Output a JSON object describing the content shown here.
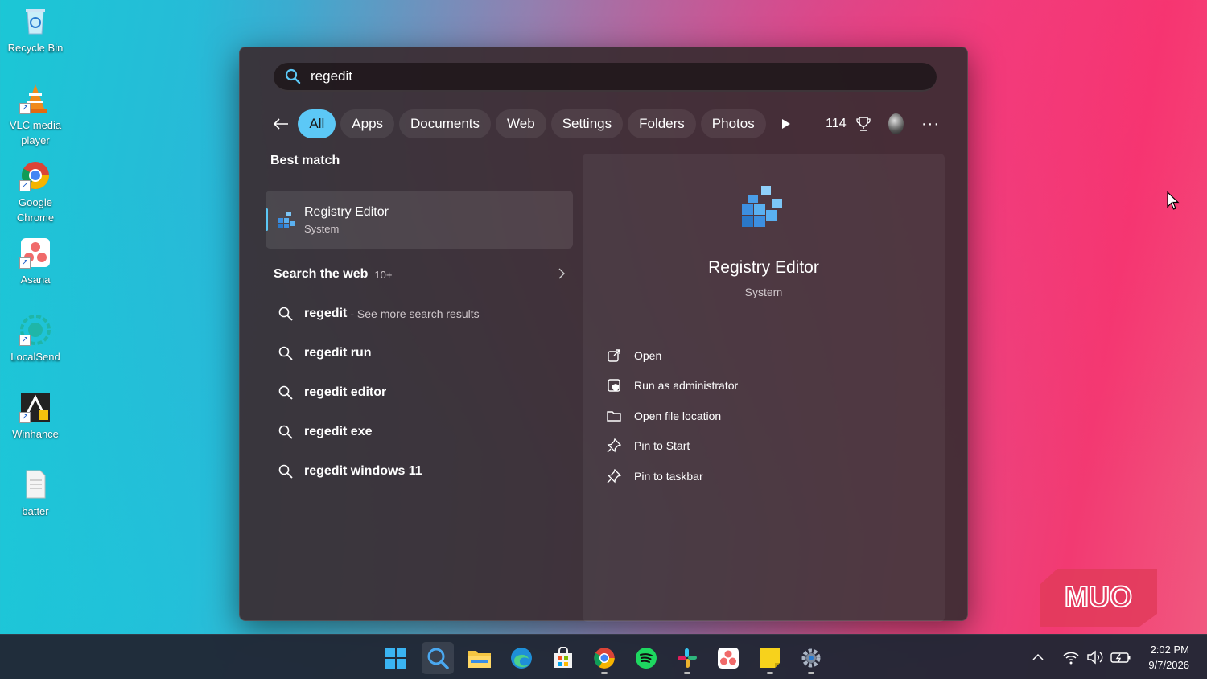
{
  "desktop": {
    "icons": [
      {
        "label": "Recycle Bin",
        "icon": "recycle-bin-icon"
      },
      {
        "label": "VLC media player",
        "icon": "vlc-icon"
      },
      {
        "label": "Google Chrome",
        "icon": "chrome-icon"
      },
      {
        "label": "Asana",
        "icon": "asana-icon"
      },
      {
        "label": "LocalSend",
        "icon": "localsend-icon"
      },
      {
        "label": "Winhance",
        "icon": "winhance-icon"
      },
      {
        "label": "batter",
        "icon": "text-file-icon"
      }
    ]
  },
  "search": {
    "query": "regedit",
    "filters": [
      "All",
      "Apps",
      "Documents",
      "Web",
      "Settings",
      "Folders",
      "Photos"
    ],
    "active_filter": "All",
    "points_count": "114"
  },
  "results": {
    "best_match_title": "Best match",
    "best_match": {
      "name": "Registry Editor",
      "type": "System"
    },
    "web_section_title": "Search the web",
    "web_section_count": "10+",
    "web_items": [
      {
        "text": "regedit",
        "sub": "- See more search results"
      },
      {
        "text": "regedit run",
        "sub": ""
      },
      {
        "text": "regedit editor",
        "sub": ""
      },
      {
        "text": "regedit exe",
        "sub": ""
      },
      {
        "text": "regedit windows 11",
        "sub": ""
      }
    ]
  },
  "detail": {
    "title": "Registry Editor",
    "subtitle": "System",
    "actions": [
      {
        "label": "Open",
        "icon": "open-external-icon"
      },
      {
        "label": "Run as administrator",
        "icon": "shield-admin-icon"
      },
      {
        "label": "Open file location",
        "icon": "folder-icon"
      },
      {
        "label": "Pin to Start",
        "icon": "pin-icon"
      },
      {
        "label": "Pin to taskbar",
        "icon": "pin-icon"
      }
    ]
  },
  "watermark": "MUO",
  "taskbar": {
    "apps": [
      "start",
      "search",
      "file-explorer",
      "edge",
      "store",
      "chrome",
      "spotify",
      "slack",
      "asana",
      "sticky-notes",
      "settings"
    ],
    "time": "2:02 PM",
    "date": "9/7/2026"
  },
  "colors": {
    "accent": "#5cc8f6",
    "panel": "#3a2c32"
  }
}
